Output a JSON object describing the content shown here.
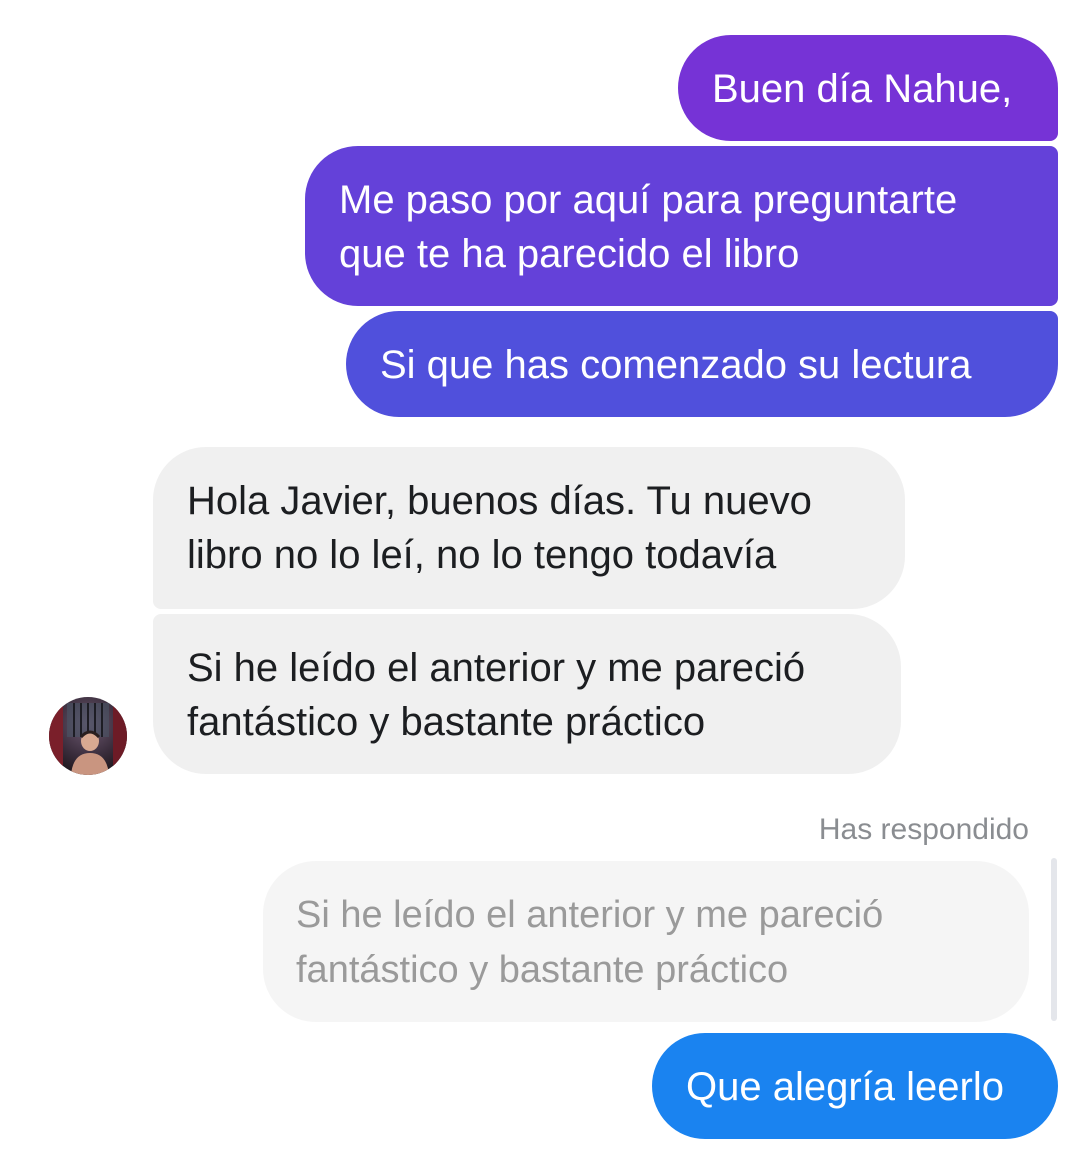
{
  "conversation": {
    "outgoing_group": [
      {
        "lines": [
          "Buen día Nahue,"
        ]
      },
      {
        "lines": [
          "Me paso por aquí para preguntarte",
          "que te ha parecido el libro"
        ]
      },
      {
        "lines": [
          "Si que has comenzado su lectura"
        ]
      }
    ],
    "incoming_group": [
      {
        "lines": [
          "Hola Javier, buenos días. Tu nuevo",
          "libro no lo leí, no lo tengo todavía"
        ]
      },
      {
        "lines": [
          "Si he leído el anterior y me pareció",
          "fantástico y bastante práctico"
        ]
      }
    ],
    "reply": {
      "label": "Has respondido",
      "quoted_lines": [
        "Si he leído el anterior y me pareció",
        "fantástico y bastante práctico"
      ],
      "message": "Que alegría leerlo"
    }
  },
  "colors": {
    "outgoing_gradient": [
      "#7633d6",
      "#6441d9",
      "#5050dc"
    ],
    "reply_bubble": "#1a83f0",
    "incoming_bubble": "#f0f0f0"
  }
}
